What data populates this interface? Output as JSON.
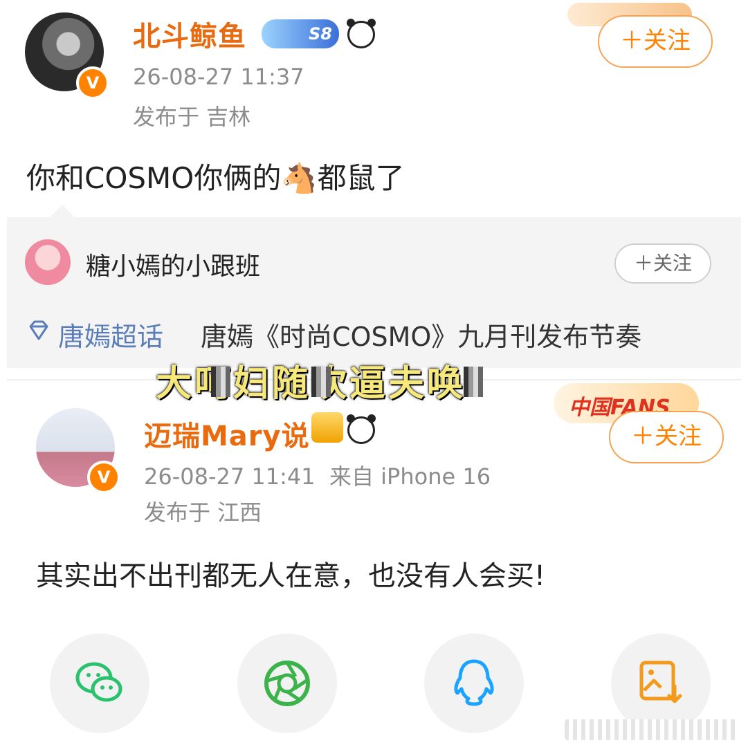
{
  "post1": {
    "username": "北斗鲸鱼",
    "level_badge": "S8",
    "timestamp": "26-08-27 11:37",
    "location": "发布于 吉林",
    "follow_label": "＋关注",
    "text_before": "你和COSMO你俩的",
    "text_emoji": "🐴",
    "text_after": "都鼠了"
  },
  "repost_card": {
    "account_name": "糖小嫣的小跟班",
    "follow_label": "＋关注",
    "topic_label": "唐嫣超话",
    "topic_text": "唐嫣《时尚COSMO》九月刊发布节奏"
  },
  "overlay_caption": "大呵妇随吹逼夫唤",
  "post2": {
    "username": "迈瑞Mary说",
    "timestamp": "26-08-27 11:41",
    "source": "来自 iPhone 16",
    "location": "发布于 江西",
    "follow_label": "＋关注",
    "decoration_text": "中国FANS",
    "text": "其实出不出刊都无人在意，也没有人会买!"
  },
  "share": {
    "items": [
      {
        "icon": "wechat-icon",
        "color": "#2bc26e"
      },
      {
        "icon": "moments-icon",
        "color": "#3cb34a"
      },
      {
        "icon": "qq-icon",
        "color": "#1aa4ff"
      },
      {
        "icon": "save-image-icon",
        "color": "#f39a1b"
      }
    ]
  },
  "colors": {
    "accent": "#ff8200",
    "username": "#e86b10",
    "meta": "#8c8c8c",
    "topic": "#5b7db8"
  }
}
